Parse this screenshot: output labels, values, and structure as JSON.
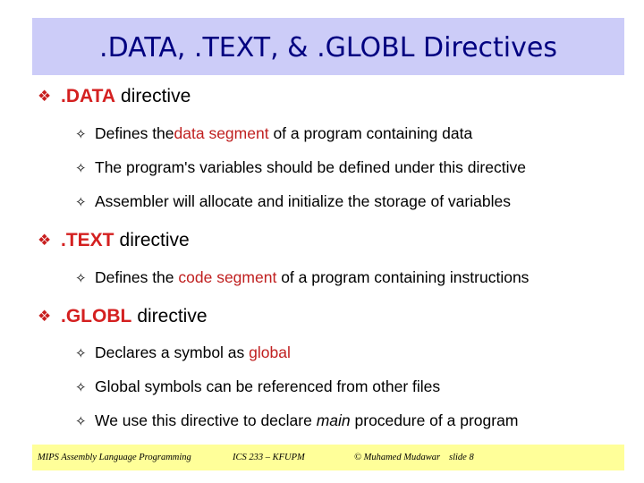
{
  "title": ".DATA, .TEXT, & .GLOBL Directives",
  "sections": [
    {
      "bullet_icon": "❖",
      "keyword": ".DATA",
      "rest": "directive",
      "items": [
        {
          "parts": [
            {
              "t": "Defines the ",
              "s": "normal"
            },
            {
              "t": "data segment",
              "s": "red"
            },
            {
              "t": " of a program containing data",
              "s": "normal"
            }
          ]
        },
        {
          "parts": [
            {
              "t": "The program's variables should be defined under this directive",
              "s": "normal"
            }
          ]
        },
        {
          "parts": [
            {
              "t": "Assembler will allocate and initialize the storage of variables",
              "s": "normal"
            }
          ]
        }
      ]
    },
    {
      "bullet_icon": "❖",
      "keyword": ".TEXT",
      "rest": "directive",
      "items": [
        {
          "parts": [
            {
              "t": "Defines the ",
              "s": "normal"
            },
            {
              "t": "code segment",
              "s": "red"
            },
            {
              "t": " of a program containing instructions",
              "s": "normal"
            }
          ]
        }
      ]
    },
    {
      "bullet_icon": "❖",
      "keyword": ".GLOBL",
      "rest": "directive",
      "items": [
        {
          "parts": [
            {
              "t": "Declares a symbol as ",
              "s": "normal"
            },
            {
              "t": "global",
              "s": "red"
            }
          ]
        },
        {
          "parts": [
            {
              "t": "Global symbols can be referenced from other files",
              "s": "normal"
            }
          ]
        },
        {
          "parts": [
            {
              "t": "We use this directive to declare ",
              "s": "normal"
            },
            {
              "t": "main",
              "s": "italic"
            },
            {
              "t": " procedure of a program",
              "s": "normal"
            }
          ]
        }
      ]
    }
  ],
  "sub_bullet_icon": "✧",
  "footer": {
    "course": "MIPS Assembly Language Programming",
    "code": "ICS 233 – KFUPM",
    "author": "© Muhamed Mudawar",
    "slide": "slide 8"
  },
  "colors": {
    "title_bg": "#ccccf8",
    "title_text": "#000080",
    "accent_red": "#c02020",
    "footer_bg": "#ffff99"
  }
}
